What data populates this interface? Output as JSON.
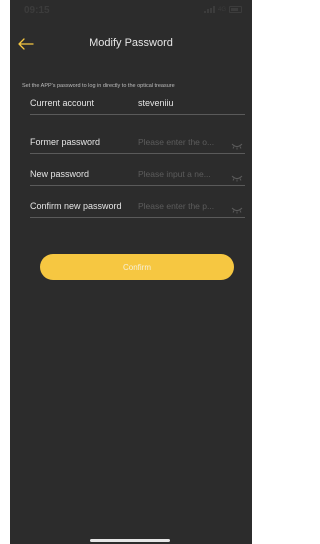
{
  "status_bar": {
    "time": "09:15",
    "network": "4G"
  },
  "header": {
    "title": "Modify Password"
  },
  "hint": "Set the APP's password to log in directly to the optical treasure",
  "form": {
    "current_account": {
      "label": "Current account",
      "value": "steveniiu"
    },
    "former_password": {
      "label": "Former password",
      "placeholder": "Please enter the o..."
    },
    "new_password": {
      "label": "New password",
      "placeholder": "Please input a ne..."
    },
    "confirm_password": {
      "label": "Confirm new password",
      "placeholder": "Please enter the p..."
    }
  },
  "confirm_button": {
    "label": "Confirm"
  },
  "icons": {
    "back": "back-arrow-icon",
    "eye": "eye-closed-icon"
  },
  "colors": {
    "background": "#2c2c2c",
    "accent": "#f6c741",
    "text": "#e6e6e6",
    "placeholder": "#5c5c5c",
    "divider": "#5a5a5a"
  }
}
